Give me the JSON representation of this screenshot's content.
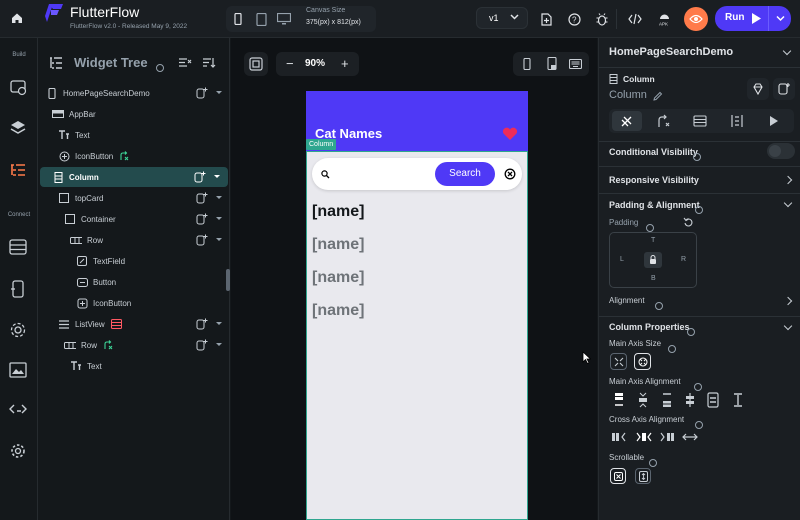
{
  "app": {
    "name": "FlutterFlow",
    "version": "FlutterFlow v2.0 - Released May 9, 2022"
  },
  "topbar": {
    "canvas_size_label": "Canvas Size",
    "canvas_size_value": "375(px) x 812(px)",
    "version_select": "v1",
    "run_label": "Run"
  },
  "rail": {
    "build_label": "Build",
    "connect_label": "Connect"
  },
  "tree": {
    "title": "Widget Tree",
    "items": [
      {
        "label": "HomePageSearchDemo"
      },
      {
        "label": "AppBar"
      },
      {
        "label": "Text"
      },
      {
        "label": "IconButton"
      },
      {
        "label": "Column"
      },
      {
        "label": "topCard"
      },
      {
        "label": "Container"
      },
      {
        "label": "Row"
      },
      {
        "label": "TextField"
      },
      {
        "label": "Button"
      },
      {
        "label": "IconButton"
      },
      {
        "label": "ListView"
      },
      {
        "label": "Row"
      },
      {
        "label": "Text"
      }
    ]
  },
  "canvas": {
    "zoom": "90%",
    "column_tag": "Column"
  },
  "phone": {
    "appbar_title": "Cat Names",
    "search_button": "Search",
    "names": [
      "[name]",
      "[name]",
      "[name]",
      "[name]"
    ]
  },
  "props": {
    "page_name": "HomePageSearchDemo",
    "widget_type": "Column",
    "widget_name": "Column",
    "conditional_visibility": "Conditional Visibility",
    "responsive_visibility": "Responsive Visibility",
    "padding_alignment": "Padding & Alignment",
    "padding": "Padding",
    "pad_top": "T",
    "pad_left": "L",
    "pad_right": "R",
    "pad_bottom": "B",
    "alignment": "Alignment",
    "column_properties": "Column Properties",
    "main_axis_size": "Main Axis Size",
    "main_axis_alignment": "Main Axis Alignment",
    "cross_axis_alignment": "Cross Axis Alignment",
    "scrollable": "Scrollable"
  },
  "colors": {
    "accent": "#4f39f6",
    "teal": "#2fa68f",
    "orange": "#ff7b4a",
    "heart": "#ee2c59"
  }
}
